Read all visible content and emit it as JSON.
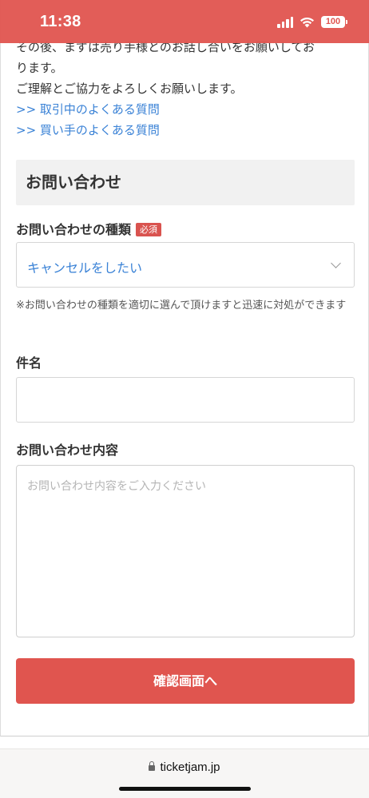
{
  "status": {
    "time": "11:38",
    "battery": "100"
  },
  "intro": {
    "line1": "その後、まずは売り手様とのお話し合いをお願いしてお",
    "line2": "ります。",
    "line3": "ご理解とご協力をよろしくお願いします。",
    "link1": ">> 取引中のよくある質問",
    "link2": ">> 買い手のよくある質問"
  },
  "section": {
    "title": "お問い合わせ"
  },
  "form": {
    "type_label": "お問い合わせの種類",
    "required_badge": "必須",
    "type_value": "キャンセルをしたい",
    "type_note": "※お問い合わせの種類を適切に選んで頂けますと迅速に対処ができます",
    "subject_label": "件名",
    "subject_value": "",
    "body_label": "お問い合わせ内容",
    "body_placeholder": "お問い合わせ内容をご入力ください",
    "submit_label": "確認画面へ"
  },
  "browser": {
    "url": "ticketjam.jp"
  },
  "colors": {
    "accent": "#e0554f",
    "link": "#3a82d6",
    "section_bg": "#f1f1f1"
  },
  "icons": [
    "chevron-down-icon",
    "lock-icon",
    "wifi-icon",
    "signal-icon",
    "battery-icon"
  ]
}
